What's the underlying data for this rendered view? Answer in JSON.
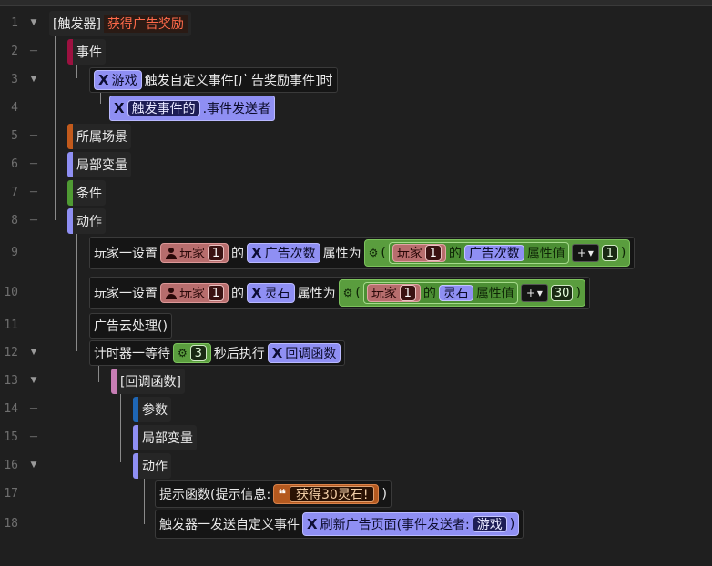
{
  "lines": [
    "1",
    "2",
    "3",
    "4",
    "5",
    "6",
    "7",
    "8",
    "9",
    "10",
    "11",
    "12",
    "13",
    "14",
    "15",
    "16",
    "17",
    "18"
  ],
  "trigger": {
    "bracket": "[触发器]",
    "name": "获得广告奖励"
  },
  "sections": {
    "event": "事件",
    "scene": "所属场景",
    "local_vars": "局部变量",
    "condition": "条件",
    "action": "动作",
    "callback_name": "[回调函数]",
    "params": "参数",
    "cb_local_vars": "局部变量",
    "cb_action": "动作"
  },
  "line3": {
    "chip": "游戏",
    "text": "触发自定义事件[广告奖励事件]时"
  },
  "line4": {
    "inner": "触发事件的",
    "text": ".事件发送者"
  },
  "line9": {
    "prefix": "玩家一设置",
    "player": "玩家",
    "num": "1",
    "of": "的",
    "attr": "广告次数",
    "set_to": "属性为",
    "paren_open": "(",
    "inner_player": "玩家",
    "inner_num": "1",
    "inner_of": "的",
    "inner_attr": "广告次数",
    "attr_val": "属性值",
    "op": "+",
    "addend": "1",
    "paren_close": ")"
  },
  "line10": {
    "prefix": "玩家一设置",
    "player": "玩家",
    "num": "1",
    "of": "的",
    "attr": "灵石",
    "set_to": "属性为",
    "paren_open": "(",
    "inner_player": "玩家",
    "inner_num": "1",
    "inner_of": "的",
    "inner_attr": "灵石",
    "attr_val": "属性值",
    "op": "+",
    "addend": "30",
    "paren_close": ")"
  },
  "line11": {
    "text": "广告云处理()"
  },
  "line12": {
    "prefix": "计时器一等待",
    "seconds": "3",
    "middle": "秒后执行",
    "callback": "回调函数"
  },
  "line17": {
    "text": "提示函数(提示信息:",
    "string": "获得30灵石!",
    "close": ")"
  },
  "line18": {
    "text": "触发器一发送自定义事件",
    "chip": "刷新广告页面(事件发送者:",
    "sender": "游戏",
    "close": ")"
  },
  "colors": {
    "event": "#9c1140",
    "scene": "#c25a1c",
    "local": "#8f8ff3",
    "condition": "#4f9a33",
    "action": "#8f8ff3",
    "callback": "#c77db4",
    "params": "#1e66b5"
  }
}
